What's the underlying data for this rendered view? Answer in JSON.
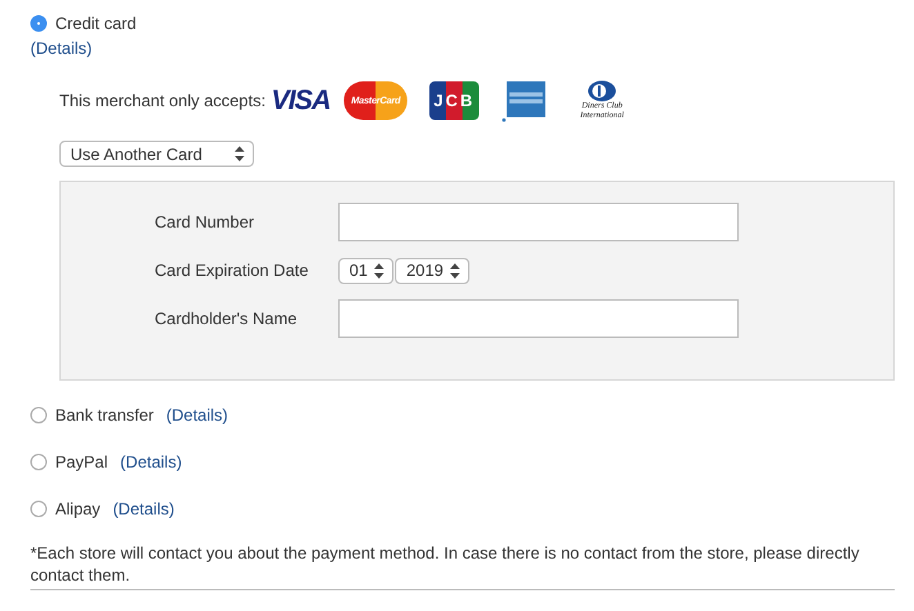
{
  "credit_card": {
    "label": "Credit card",
    "selected": true,
    "details": "(Details)",
    "accepts_label": "This merchant only accepts:",
    "cards": [
      {
        "kind": "visa",
        "label": "VISA"
      },
      {
        "kind": "mastercard",
        "label": "MasterCard"
      },
      {
        "kind": "jcb",
        "label": "JCB"
      },
      {
        "kind": "amex"
      },
      {
        "kind": "diners",
        "label": "Diners Club International"
      }
    ],
    "card_select": "Use Another Card",
    "form": {
      "card_number_label": "Card Number",
      "expiration_label": "Card Expiration Date",
      "month": "01",
      "year": "2019",
      "name_label": "Cardholder's Name"
    }
  },
  "other_methods": [
    {
      "label": "Bank transfer",
      "details": "(Details)",
      "selected": false
    },
    {
      "label": "PayPal",
      "details": "(Details)",
      "selected": false
    },
    {
      "label": "Alipay",
      "details": "(Details)",
      "selected": false
    }
  ],
  "note": "*Each store will contact you about the payment method. In case there is no contact from the store, please directly contact them."
}
